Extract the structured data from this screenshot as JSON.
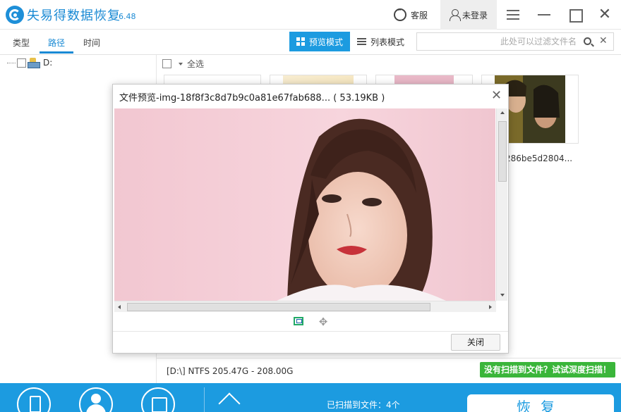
{
  "app": {
    "title": "失易得数据恢复",
    "version": "6.48"
  },
  "header": {
    "service_label": "客服",
    "login_label": "未登录"
  },
  "tabs": [
    {
      "label": "类型"
    },
    {
      "label": "路径"
    },
    {
      "label": "时间"
    }
  ],
  "view_modes": {
    "preview_label": "预览模式",
    "list_label": "列表模式"
  },
  "filter": {
    "placeholder": "此处可以过滤文件名",
    "value": ""
  },
  "tree": {
    "drive_label": "D:"
  },
  "main": {
    "select_all_label": "全选",
    "visible_file_name": "g-286be5d2804..."
  },
  "status": {
    "disk_info": "[D:\\] NTFS 205.47G - 208.00G",
    "deep_scan_label": "没有扫描到文件？试试深度扫描！"
  },
  "bottom": {
    "scan_count": "已扫描到文件：4个",
    "recover_label": "恢复"
  },
  "dialog": {
    "title": "文件预览-img-18f8f3c8d7b9c0a81e67fab688... ( 53.19KB )",
    "close_label": "关闭"
  },
  "colors": {
    "accent": "#1c9be0",
    "brand": "#1a8ad4",
    "success": "#3ab53a"
  }
}
